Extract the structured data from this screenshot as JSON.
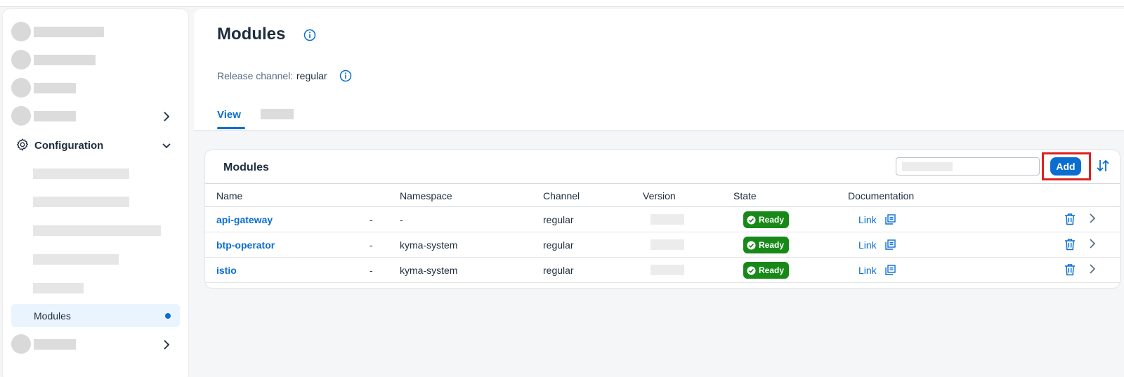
{
  "sidebar": {
    "config_label": "Configuration",
    "active_item_label": "Modules"
  },
  "header": {
    "title": "Modules",
    "release_label": "Release channel:",
    "release_value": "regular",
    "tabs": [
      {
        "label": "View"
      }
    ]
  },
  "card": {
    "title": "Modules",
    "add_label": "Add",
    "columns": [
      "Name",
      "Namespace",
      "Channel",
      "Version",
      "State",
      "Documentation"
    ],
    "rows": [
      {
        "name": "api-gateway",
        "dash": "-",
        "namespace": "-",
        "channel": "regular",
        "state": "Ready",
        "doc": "Link"
      },
      {
        "name": "btp-operator",
        "dash": "-",
        "namespace": "kyma-system",
        "channel": "regular",
        "state": "Ready",
        "doc": "Link"
      },
      {
        "name": "istio",
        "dash": "-",
        "namespace": "kyma-system",
        "channel": "regular",
        "state": "Ready",
        "doc": "Link"
      }
    ]
  },
  "colors": {
    "accent": "#0a6ed1",
    "success": "#188918",
    "highlight": "#e02020"
  },
  "icons": [
    "gear-icon",
    "chevron-down-icon",
    "chevron-right-icon",
    "info-icon",
    "sort-icon",
    "check-circle-icon",
    "external-link-icon",
    "trash-icon"
  ]
}
